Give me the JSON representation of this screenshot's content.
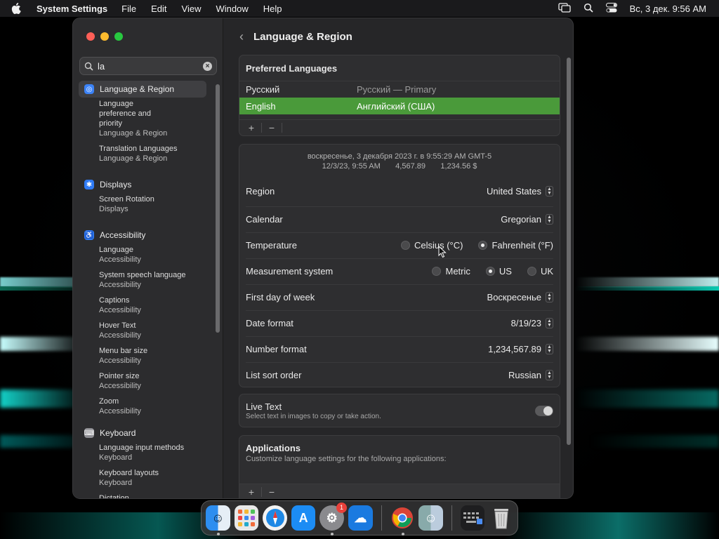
{
  "menubar": {
    "app": "System Settings",
    "items": [
      "File",
      "Edit",
      "View",
      "Window",
      "Help"
    ],
    "clock": "Вс, 3 дек.  9:56 AM"
  },
  "sidebar": {
    "search_value": "la",
    "results": [
      {
        "category": "Language & Region",
        "icon": "globe-icon",
        "color": "#3b82f6",
        "selected": true,
        "subs": [
          {
            "line1": "Language preference and priority",
            "line2": "Language & Region"
          },
          {
            "line1": "Translation Languages",
            "line2": "Language & Region"
          }
        ]
      },
      {
        "category": "Displays",
        "icon": "sun-icon",
        "color": "#2f7bf5",
        "subs": [
          {
            "line1": "Screen Rotation",
            "line2": "Displays"
          }
        ]
      },
      {
        "category": "Accessibility",
        "icon": "accessibility-icon",
        "color": "#2f7bf5",
        "subs": [
          {
            "line1": "Language",
            "line2": "Accessibility"
          },
          {
            "line1": "System speech language",
            "line2": "Accessibility"
          },
          {
            "line1": "Captions",
            "line2": "Accessibility"
          },
          {
            "line1": "Hover Text",
            "line2": "Accessibility"
          },
          {
            "line1": "Menu bar size",
            "line2": "Accessibility"
          },
          {
            "line1": "Pointer size",
            "line2": "Accessibility"
          },
          {
            "line1": "Zoom",
            "line2": "Accessibility"
          }
        ]
      },
      {
        "category": "Keyboard",
        "icon": "keyboard-icon",
        "color": "#8e8e93",
        "subs": [
          {
            "line1": "Language input methods",
            "line2": "Keyboard"
          },
          {
            "line1": "Keyboard layouts",
            "line2": "Keyboard"
          },
          {
            "line1": "Dictation",
            "line2": ""
          }
        ]
      }
    ]
  },
  "main": {
    "title": "Language & Region",
    "preferred": {
      "heading": "Preferred Languages",
      "languages": [
        {
          "name": "Русский",
          "detail": "Русский — Primary",
          "selected": false
        },
        {
          "name": "English",
          "detail": "Английский (США)",
          "selected": true
        }
      ],
      "add": "+",
      "remove": "−"
    },
    "preview": {
      "line1": "воскресенье, 3 декабря 2023 г. в 9:55:29 AM GMT-5",
      "line2": "12/3/23, 9:55 AM       4,567.89       1,234.56 $"
    },
    "settings": {
      "region_label": "Region",
      "region_value": "United States",
      "calendar_label": "Calendar",
      "calendar_value": "Gregorian",
      "temperature_label": "Temperature",
      "celsius": "Celsius (°C)",
      "fahrenheit": "Fahrenheit (°F)",
      "measurement_label": "Measurement system",
      "metric": "Metric",
      "us": "US",
      "uk": "UK",
      "firstday_label": "First day of week",
      "firstday_value": "Воскресенье",
      "dateformat_label": "Date format",
      "dateformat_value": "8/19/23",
      "numberformat_label": "Number format",
      "numberformat_value": "1,234,567.89",
      "listsort_label": "List sort order",
      "listsort_value": "Russian"
    },
    "live_text": {
      "title": "Live Text",
      "desc": "Select text in images to copy or take action.",
      "on": true
    },
    "applications": {
      "title": "Applications",
      "desc": "Customize language settings for the following applications:"
    }
  },
  "dock": {
    "settings_badge": "1"
  },
  "colors": {
    "accent_selection": "#4a9a3a",
    "window_bg": "#262628"
  }
}
